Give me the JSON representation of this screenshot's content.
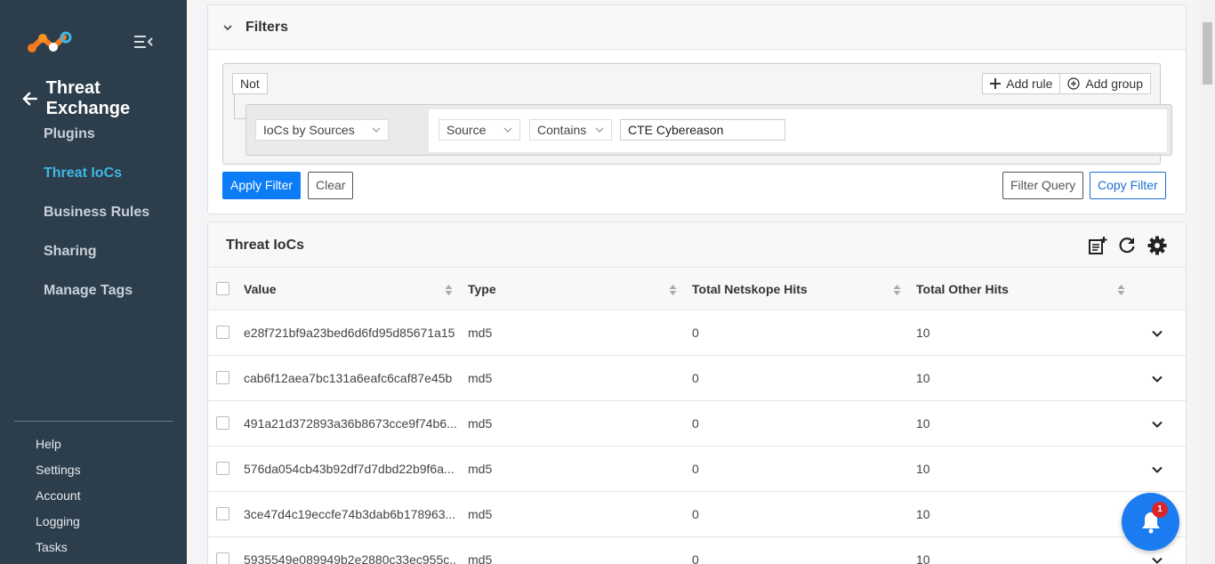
{
  "sidebar": {
    "page_title": "Threat Exchange",
    "nav": [
      {
        "label": "Plugins",
        "active": false
      },
      {
        "label": "Threat IoCs",
        "active": true
      },
      {
        "label": "Business Rules",
        "active": false
      },
      {
        "label": "Sharing",
        "active": false
      },
      {
        "label": "Manage Tags",
        "active": false
      }
    ],
    "bottom_nav": [
      "Help",
      "Settings",
      "Account",
      "Logging",
      "Tasks"
    ],
    "colors": {
      "background": "#2c3e4c",
      "active": "#3fb6e6"
    }
  },
  "filters": {
    "title": "Filters",
    "not_label": "Not",
    "add_rule_label": "Add rule",
    "add_group_label": "Add group",
    "rule": {
      "field": "IoCs by Sources",
      "subfield": "Source",
      "operator": "Contains",
      "value": "CTE Cybereason"
    },
    "apply_label": "Apply Filter",
    "clear_label": "Clear",
    "filter_query_label": "Filter Query",
    "copy_filter_label": "Copy Filter"
  },
  "iocs": {
    "title": "Threat IoCs",
    "header_icons": [
      "export-icon",
      "refresh-icon",
      "gear-icon"
    ],
    "columns": [
      "Value",
      "Type",
      "Total Netskope Hits",
      "Total Other Hits"
    ],
    "rows": [
      {
        "value": "e28f721bf9a23bed6d6fd95d85671a15",
        "type": "md5",
        "netskope_hits": "0",
        "other_hits": "10"
      },
      {
        "value": "cab6f12aea7bc131a6eafc6caf87e45b",
        "type": "md5",
        "netskope_hits": "0",
        "other_hits": "10"
      },
      {
        "value": "491a21d372893a36b8673cce9f74b6...",
        "type": "md5",
        "netskope_hits": "0",
        "other_hits": "10"
      },
      {
        "value": "576da054cb43b92df7d7dbd22b9f6a...",
        "type": "md5",
        "netskope_hits": "0",
        "other_hits": "10"
      },
      {
        "value": "3ce47d4c19eccfe74b3dab6b178963...",
        "type": "md5",
        "netskope_hits": "0",
        "other_hits": "10"
      },
      {
        "value": "5935549e089949b2e2880c33ec955c...",
        "type": "md5",
        "netskope_hits": "0",
        "other_hits": "10"
      }
    ]
  },
  "notifications": {
    "count": "1",
    "color": "#1a7cf0",
    "badge_color": "#d9262c"
  }
}
